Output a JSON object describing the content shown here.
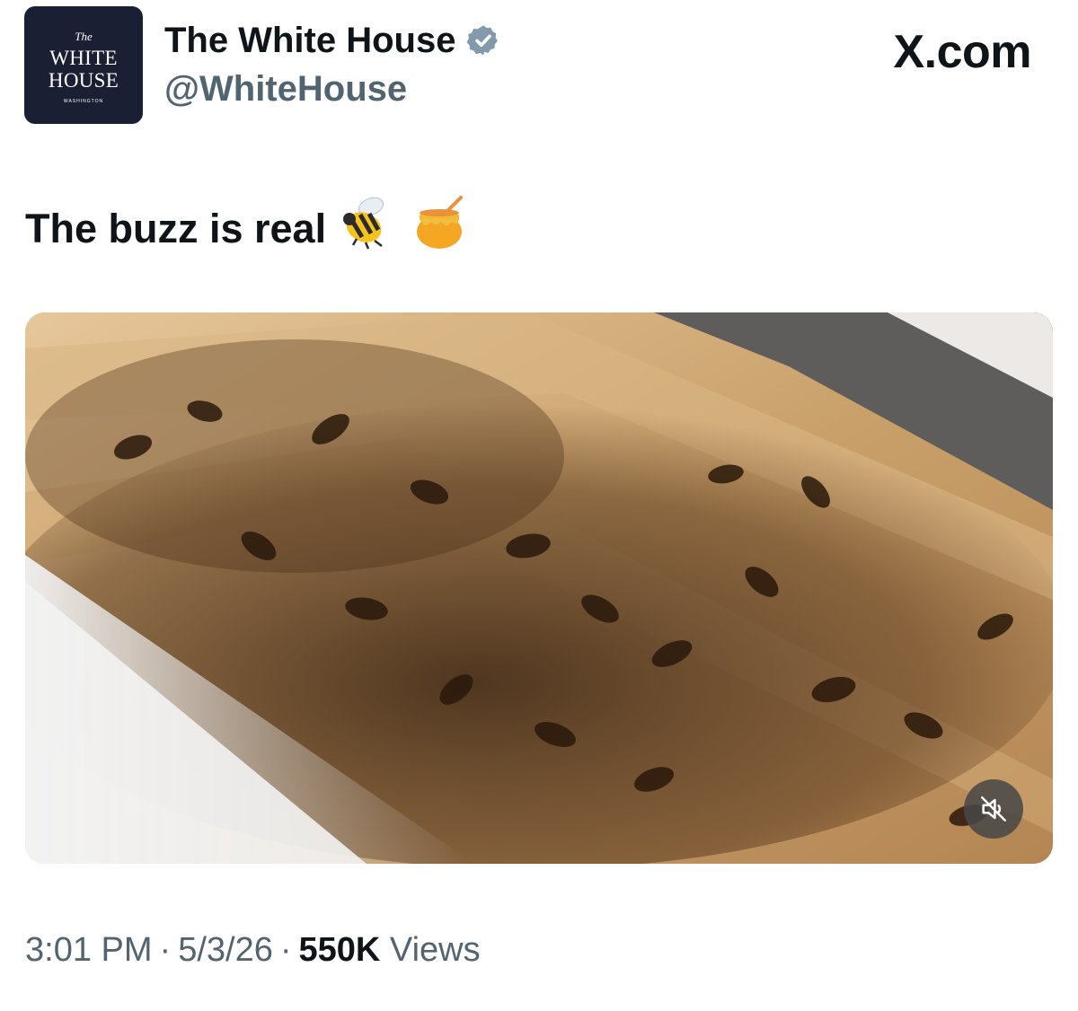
{
  "account": {
    "avatar_text": {
      "top": "The",
      "line1": "WHITE",
      "line2": "HOUSE",
      "bottom": "WASHINGTON"
    },
    "display_name": "The White House",
    "handle": "@WhiteHouse",
    "verified_icon": "verified-badge",
    "verified_color": "#829aab"
  },
  "brand": {
    "label": ".com",
    "logo": "X"
  },
  "tweet": {
    "text": "The buzz is real",
    "emojis": [
      "bee-emoji",
      "honey-pot-emoji"
    ]
  },
  "media": {
    "description_icon": "bees-on-hive-frames-video",
    "mute_icon": "sound-off-icon"
  },
  "meta": {
    "time": "3:01 PM",
    "separator": "·",
    "date": "5/3/26",
    "views_count": "550K",
    "views_label": "Views"
  },
  "colors": {
    "text_primary": "#0f1419",
    "text_secondary": "#536471",
    "avatar_bg": "#1b1f33"
  }
}
